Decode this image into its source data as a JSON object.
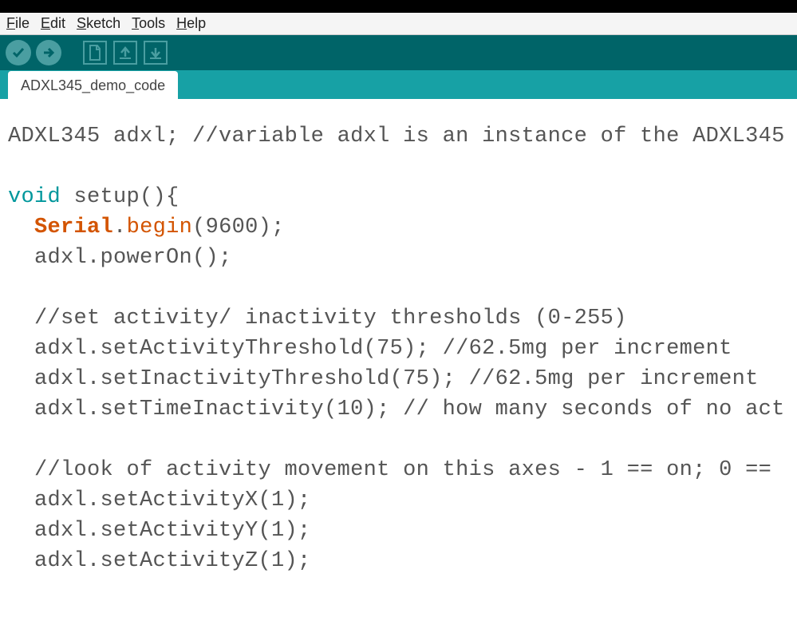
{
  "menubar": {
    "file": "File",
    "edit": "Edit",
    "sketch": "Sketch",
    "tools": "Tools",
    "help": "Help"
  },
  "tabs": {
    "main": "ADXL345_demo_code"
  },
  "code": {
    "l1a": "ADXL345 adxl; ",
    "l1b": "//variable adxl is an instance of the ADXL345",
    "l2": "",
    "l3_kw": "void",
    "l3_rest": " setup(){",
    "l4_indent": "  ",
    "l4_obj": "Serial",
    "l4_dot": ".",
    "l4_fn": "begin",
    "l4_args": "(9600);",
    "l5": "  adxl.powerOn();",
    "l6": "",
    "l7": "  //set activity/ inactivity thresholds (0-255)",
    "l8": "  adxl.setActivityThreshold(75); //62.5mg per increment",
    "l9": "  adxl.setInactivityThreshold(75); //62.5mg per increment",
    "l10": "  adxl.setTimeInactivity(10); // how many seconds of no act",
    "l11": "",
    "l12": "  //look of activity movement on this axes - 1 == on; 0 ==",
    "l13": "  adxl.setActivityX(1);",
    "l14": "  adxl.setActivityY(1);",
    "l15": "  adxl.setActivityZ(1);"
  }
}
